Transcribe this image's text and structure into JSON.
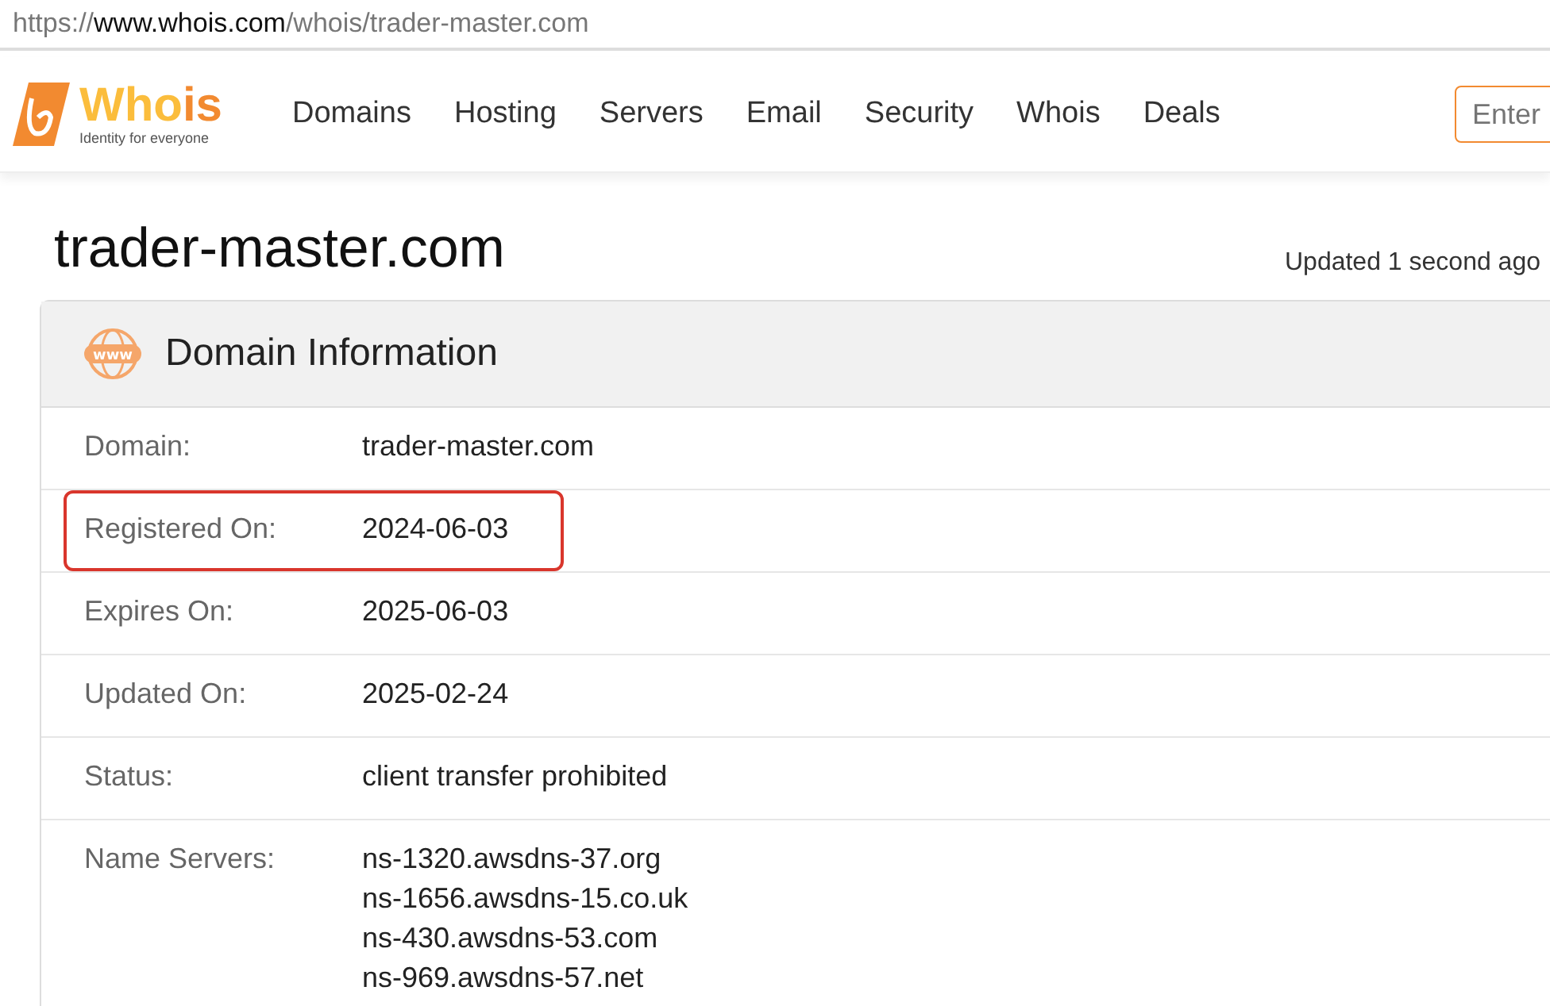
{
  "address_bar": {
    "url_prefix": "https://",
    "url_domain": "www.whois.com",
    "url_path": "/whois/trader-master.com"
  },
  "header": {
    "logo": {
      "word_a": "Who",
      "word_b": "is",
      "tagline": "Identity for everyone"
    },
    "nav": [
      "Domains",
      "Hosting",
      "Servers",
      "Email",
      "Security",
      "Whois",
      "Deals"
    ],
    "search": {
      "placeholder": "Enter"
    }
  },
  "page": {
    "title": "trader-master.com",
    "updated": "Updated 1 second ago"
  },
  "card": {
    "icon_text": "www",
    "title": "Domain Information",
    "rows": [
      {
        "label": "Domain:",
        "values": [
          "trader-master.com"
        ],
        "highlighted": false
      },
      {
        "label": "Registered On:",
        "values": [
          "2024-06-03"
        ],
        "highlighted": true
      },
      {
        "label": "Expires On:",
        "values": [
          "2025-06-03"
        ],
        "highlighted": false
      },
      {
        "label": "Updated On:",
        "values": [
          "2025-02-24"
        ],
        "highlighted": false
      },
      {
        "label": "Status:",
        "values": [
          "client transfer prohibited"
        ],
        "highlighted": false
      },
      {
        "label": "Name Servers:",
        "values": [
          "ns-1320.awsdns-37.org",
          "ns-1656.awsdns-15.co.uk",
          "ns-430.awsdns-53.com",
          "ns-969.awsdns-57.net"
        ],
        "highlighted": false
      }
    ]
  }
}
